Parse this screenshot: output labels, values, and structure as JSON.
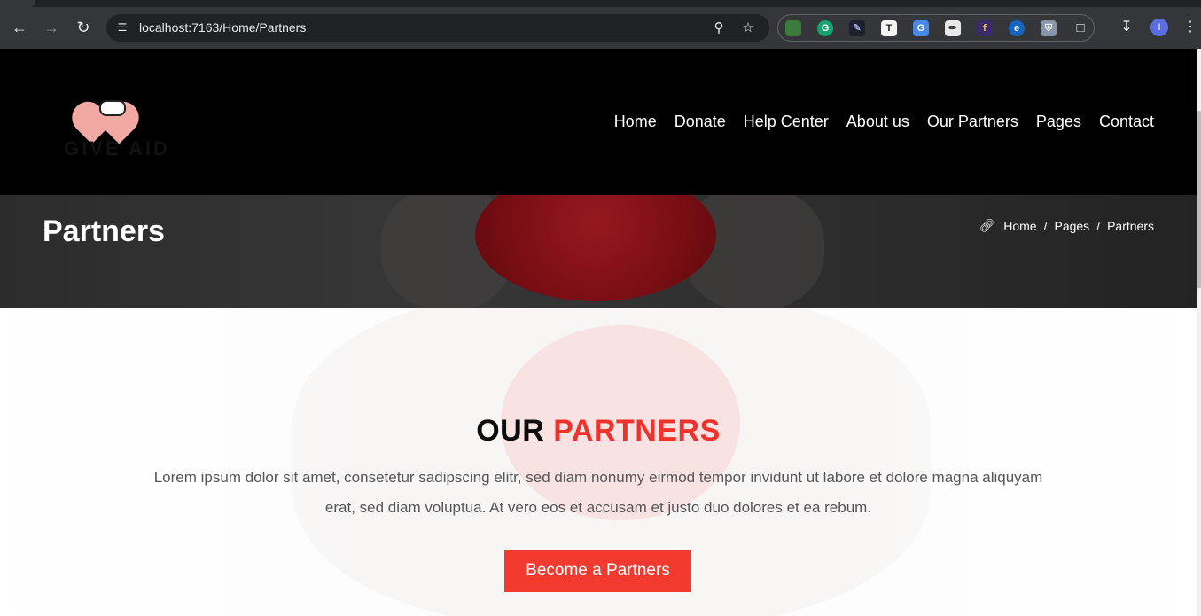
{
  "browser": {
    "url": "localhost:7163/Home/Partners",
    "profile_initial": "I",
    "extensions": [
      "colorful-extension",
      "grammarly",
      "eyedropper",
      "text-extension",
      "google-translate",
      "drawing-extension",
      "tfs-extension",
      "edge-extension",
      "shield-extension"
    ],
    "accent": "#35363a"
  },
  "header": {
    "logo_text": "GIVE AID",
    "nav": [
      "Home",
      "Donate",
      "Help Center",
      "About us",
      "Our Partners",
      "Pages",
      "Contact"
    ]
  },
  "banner": {
    "title": "Partners",
    "breadcrumb": [
      "Home",
      "Pages",
      "Partners"
    ],
    "separator": "/"
  },
  "section": {
    "title_dark": "OUR",
    "title_accent": "PARTNERS",
    "text": "Lorem ipsum dolor sit amet, consetetur sadipscing elitr, sed diam nonumy eirmod tempor invidunt ut labore et dolore magna aliquyam erat, sed diam voluptua. At vero eos et accusam et justo duo dolores et ea rebum.",
    "button": "Become a Partners",
    "accent_color": "#f33a2f"
  }
}
